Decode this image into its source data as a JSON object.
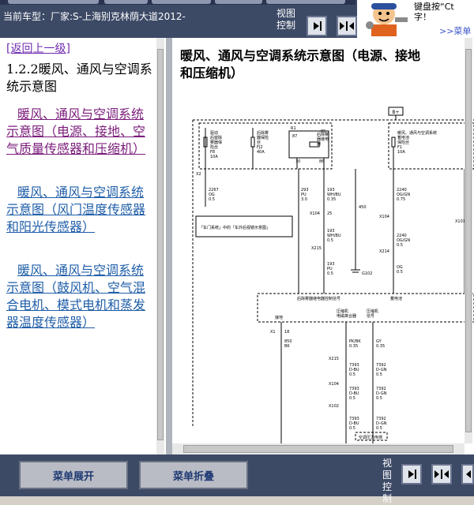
{
  "header": {
    "vehicle_info": "当前车型：厂家:S-上海别克林荫大道2012-",
    "view_control_label": "视图控制",
    "help_text_line1": "键盘按“Ct",
    "help_text_line2": "字！",
    "help_link": ">>菜单"
  },
  "sidebar": {
    "back_link": "[返回上一级]",
    "section_heading": "1.2.2暖风、通风与空调系统示意图",
    "items": [
      {
        "label": "暖风、通风与空调系统示意图（电源、接地、空气质量传感器和压缩机）",
        "state": "visited"
      },
      {
        "label": "暖风、通风与空调系统示意图（风门温度传感器和阳光传感器）",
        "state": "link"
      },
      {
        "label": "暖风、通风与空调系统示意图（鼓风机、空气混合电机、模式电机和蒸发器温度传感器）",
        "state": "link"
      }
    ]
  },
  "content": {
    "title_line1": "暖风、通风与空调系统示意图（电源、接地",
    "title_line2": "和压缩机）"
  },
  "diagram_labels": {
    "b_plus": "B+",
    "fuse1": "驱动\n后窗除\n雾器保\n险丝\nF8\n10A",
    "fuse2": "后除雾\n器保险\n丝\nFJ2\n40A",
    "relay": "后除雾\n器继电\n器",
    "r1": "R1",
    "p87": "87",
    "p85": "85",
    "p86": "86",
    "p30": "30",
    "fuse3": "暖风、通风与空调系统\n蓄电池\n保险丝\nF1\n10A",
    "x2_8": "X2",
    "w1_code": "2267\nOG\n0.5",
    "w2_code": "293\nPU\n3.0",
    "w3_code": "193\nWH/BU\n0.35",
    "w4_code": "450",
    "w5_code": "2240\nOG/GN\n0.75",
    "x104_25": "X104",
    "x104_n": "25",
    "box_note": "「车门系统」中的「车外后视镜示意图」",
    "w6_code": "193\nWH/BU\n0.5",
    "w7_code": "2240\nOG/GN\n0.5",
    "x215_8": "X215",
    "x214_8": "X214",
    "w8_code": "193\nPU\n0.5",
    "g102": "G102",
    "w9_code": "OG\n0.5",
    "x101": "X101",
    "module_left": "后除雾器继电器控制信号",
    "module_mid": "蓄电池",
    "comp_clutch": "压缩机\n电磁离合器",
    "comp_signal": "压缩机\n信号",
    "ground": "接地",
    "x1_18": "X1",
    "pin18": "18",
    "w10_code": "850\nBK",
    "w11_code": "PK/BK\n0.35",
    "w12_code": "GY\n0.35",
    "x215_b": "X215",
    "w13_code": "7393\nD-BU\n0.5",
    "w14_code": "7392\nD-GN\n0.5",
    "x104_b": "X104",
    "w15_code": "7393\nD-BU\n0.5",
    "w16_code": "7392\nD-GN\n0.5",
    "x102": "X102",
    "w17_code": "7393\nD-BU\n0.5",
    "w18_code": "7392\nD-GN\n0.5",
    "bottom_mod": "空调压力传感"
  },
  "bottom": {
    "expand_button": "菜单展开",
    "collapse_button": "菜单折叠",
    "view_control_label": "视图控制"
  }
}
